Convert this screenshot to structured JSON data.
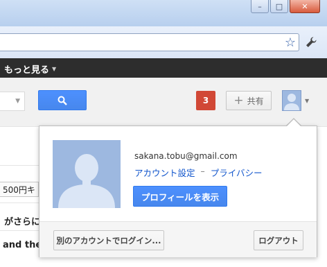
{
  "window": {
    "minimize_glyph": "–",
    "maximize_glyph": "□",
    "close_glyph": "✕"
  },
  "toolbar": {
    "star_glyph": "☆",
    "wrench_glyph": "🔧"
  },
  "gbar": {
    "more_label": "もっと見る",
    "more_caret": "▼"
  },
  "search": {
    "button_icon": "search-icon"
  },
  "header": {
    "notification_count": "3",
    "share_plus": "+",
    "share_label": "共有",
    "avatar_caret": "▼"
  },
  "background": {
    "price_text": "500円キ",
    "text1": "がさらに便",
    "text2": "and the"
  },
  "popup": {
    "email": "sakana.tobu@gmail.com",
    "account_settings": "アカウント設定",
    "separator": "–",
    "privacy": "プライバシー",
    "view_profile": "プロフィールを表示",
    "login_other": "別のアカウントでログイン...",
    "logout": "ログアウト"
  },
  "colors": {
    "accent_blue": "#4d90fe",
    "notification_red": "#d14836",
    "link_blue": "#1155cc",
    "gbar_dark": "#2d2d2d"
  }
}
